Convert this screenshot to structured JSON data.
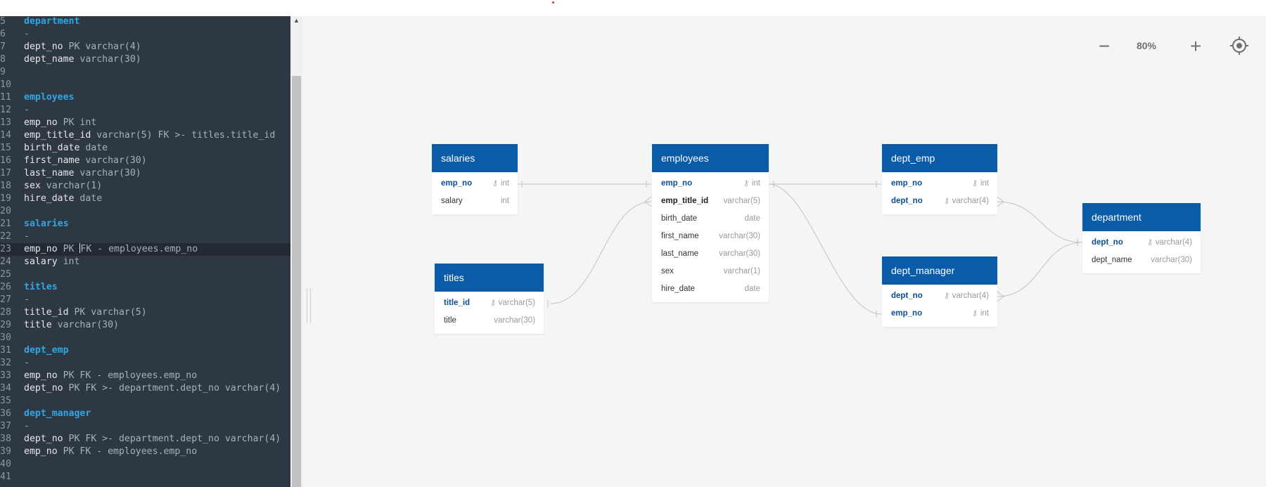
{
  "editor": {
    "lines": [
      {
        "n": "5",
        "parts": [
          {
            "t": "department",
            "c": "table"
          }
        ]
      },
      {
        "n": "6",
        "parts": [
          {
            "t": "-",
            "c": "type"
          }
        ]
      },
      {
        "n": "7",
        "parts": [
          {
            "t": "dept_no",
            "c": "field"
          },
          {
            "t": " PK varchar(4)",
            "c": "type"
          }
        ]
      },
      {
        "n": "8",
        "parts": [
          {
            "t": "dept_name",
            "c": "field"
          },
          {
            "t": " varchar(30)",
            "c": "type"
          }
        ]
      },
      {
        "n": "9",
        "parts": []
      },
      {
        "n": "10",
        "parts": []
      },
      {
        "n": "11",
        "parts": [
          {
            "t": "employees",
            "c": "table"
          }
        ]
      },
      {
        "n": "12",
        "parts": [
          {
            "t": "-",
            "c": "type"
          }
        ]
      },
      {
        "n": "13",
        "parts": [
          {
            "t": "emp_no",
            "c": "field"
          },
          {
            "t": " PK int",
            "c": "type"
          }
        ]
      },
      {
        "n": "14",
        "parts": [
          {
            "t": "emp_title_id",
            "c": "field"
          },
          {
            "t": " varchar(5) FK >- titles.title_id",
            "c": "type"
          }
        ]
      },
      {
        "n": "15",
        "parts": [
          {
            "t": "birth_date",
            "c": "field"
          },
          {
            "t": " date",
            "c": "type"
          }
        ]
      },
      {
        "n": "16",
        "parts": [
          {
            "t": "first_name",
            "c": "field"
          },
          {
            "t": " varchar(30)",
            "c": "type"
          }
        ]
      },
      {
        "n": "17",
        "parts": [
          {
            "t": "last_name",
            "c": "field"
          },
          {
            "t": " varchar(30)",
            "c": "type"
          }
        ]
      },
      {
        "n": "18",
        "parts": [
          {
            "t": "sex",
            "c": "field"
          },
          {
            "t": " varchar(1)",
            "c": "type"
          }
        ]
      },
      {
        "n": "19",
        "parts": [
          {
            "t": "hire_date",
            "c": "field"
          },
          {
            "t": " date",
            "c": "type"
          }
        ]
      },
      {
        "n": "20",
        "parts": []
      },
      {
        "n": "21",
        "parts": [
          {
            "t": "salaries",
            "c": "table"
          }
        ]
      },
      {
        "n": "22",
        "parts": [
          {
            "t": "-",
            "c": "type"
          }
        ]
      },
      {
        "n": "23",
        "current": true,
        "parts": [
          {
            "t": "emp_no",
            "c": "field"
          },
          {
            "t": " PK ",
            "c": "type"
          },
          {
            "t": "",
            "c": "caret"
          },
          {
            "t": "FK - employees.emp_no",
            "c": "type"
          }
        ]
      },
      {
        "n": "24",
        "parts": [
          {
            "t": "salary",
            "c": "field"
          },
          {
            "t": " int",
            "c": "type"
          }
        ]
      },
      {
        "n": "25",
        "parts": []
      },
      {
        "n": "26",
        "parts": [
          {
            "t": "titles",
            "c": "table"
          }
        ]
      },
      {
        "n": "27",
        "parts": [
          {
            "t": "-",
            "c": "type"
          }
        ]
      },
      {
        "n": "28",
        "parts": [
          {
            "t": "title_id",
            "c": "field"
          },
          {
            "t": " PK varchar(5)",
            "c": "type"
          }
        ]
      },
      {
        "n": "29",
        "parts": [
          {
            "t": "title",
            "c": "field"
          },
          {
            "t": " varchar(30)",
            "c": "type"
          }
        ]
      },
      {
        "n": "30",
        "parts": []
      },
      {
        "n": "31",
        "parts": [
          {
            "t": "dept_emp",
            "c": "table"
          }
        ]
      },
      {
        "n": "32",
        "parts": [
          {
            "t": "-",
            "c": "type"
          }
        ]
      },
      {
        "n": "33",
        "parts": [
          {
            "t": "emp_no",
            "c": "field"
          },
          {
            "t": " PK FK - employees.emp_no",
            "c": "type"
          }
        ]
      },
      {
        "n": "34",
        "parts": [
          {
            "t": "dept_no",
            "c": "field"
          },
          {
            "t": " PK FK >- department.dept_no varchar(4)",
            "c": "type"
          }
        ]
      },
      {
        "n": "35",
        "parts": []
      },
      {
        "n": "36",
        "parts": [
          {
            "t": "dept_manager",
            "c": "table"
          }
        ]
      },
      {
        "n": "37",
        "parts": [
          {
            "t": "-",
            "c": "type"
          }
        ]
      },
      {
        "n": "38",
        "parts": [
          {
            "t": "dept_no",
            "c": "field"
          },
          {
            "t": " PK FK >- department.dept_no varchar(4)",
            "c": "type"
          }
        ]
      },
      {
        "n": "39",
        "parts": [
          {
            "t": "emp_no",
            "c": "field"
          },
          {
            "t": " PK FK - employees.emp_no",
            "c": "type"
          }
        ]
      },
      {
        "n": "40",
        "parts": []
      },
      {
        "n": "41",
        "parts": []
      }
    ]
  },
  "zoom": {
    "minus_label": "−",
    "level": "80%",
    "plus_label": "+",
    "locate_icon": "crosshair-icon"
  },
  "colors": {
    "header": "#0a5ba8",
    "editor_bg": "#2e3842",
    "keyword": "#2fa7e6",
    "canvas_bg": "#f4f5f5"
  },
  "tables": {
    "salaries": {
      "name": "salaries",
      "fields": [
        {
          "name": "emp_no",
          "type": "int",
          "key": "pk"
        },
        {
          "name": "salary",
          "type": "int",
          "key": ""
        }
      ]
    },
    "titles": {
      "name": "titles",
      "fields": [
        {
          "name": "title_id",
          "type": "varchar(5)",
          "key": "pk"
        },
        {
          "name": "title",
          "type": "varchar(30)",
          "key": ""
        }
      ]
    },
    "employees": {
      "name": "employees",
      "fields": [
        {
          "name": "emp_no",
          "type": "int",
          "key": "pk"
        },
        {
          "name": "emp_title_id",
          "type": "varchar(5)",
          "key": "fk"
        },
        {
          "name": "birth_date",
          "type": "date",
          "key": ""
        },
        {
          "name": "first_name",
          "type": "varchar(30)",
          "key": ""
        },
        {
          "name": "last_name",
          "type": "varchar(30)",
          "key": ""
        },
        {
          "name": "sex",
          "type": "varchar(1)",
          "key": ""
        },
        {
          "name": "hire_date",
          "type": "date",
          "key": ""
        }
      ]
    },
    "dept_emp": {
      "name": "dept_emp",
      "fields": [
        {
          "name": "emp_no",
          "type": "int",
          "key": "pk"
        },
        {
          "name": "dept_no",
          "type": "varchar(4)",
          "key": "pk"
        }
      ]
    },
    "dept_manager": {
      "name": "dept_manager",
      "fields": [
        {
          "name": "dept_no",
          "type": "varchar(4)",
          "key": "pk"
        },
        {
          "name": "emp_no",
          "type": "int",
          "key": "pk"
        }
      ]
    },
    "department": {
      "name": "department",
      "fields": [
        {
          "name": "dept_no",
          "type": "varchar(4)",
          "key": "pk"
        },
        {
          "name": "dept_name",
          "type": "varchar(30)",
          "key": ""
        }
      ]
    }
  }
}
